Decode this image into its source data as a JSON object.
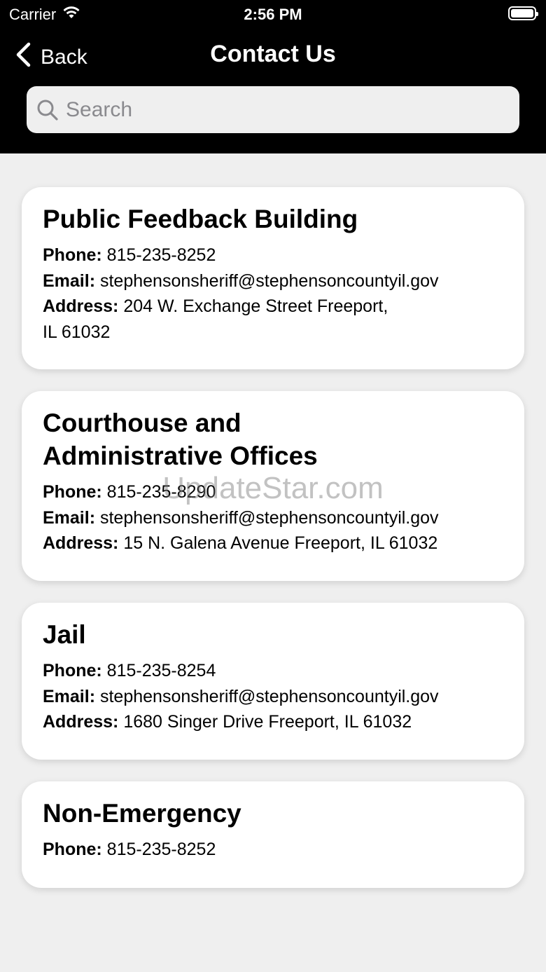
{
  "status_bar": {
    "carrier": "Carrier",
    "time": "2:56 PM"
  },
  "nav": {
    "back_label": "Back",
    "title": "Contact Us"
  },
  "search": {
    "placeholder": "Search",
    "value": ""
  },
  "labels": {
    "phone": "Phone:",
    "email": "Email:",
    "address": "Address:"
  },
  "contacts": [
    {
      "name": "Public Feedback Building",
      "phone": "815-235-8252",
      "email": "stephensonsheriff@stephensoncountyil.gov",
      "address_line1": "204 W. Exchange Street Freeport,",
      "address_line2": "IL 61032"
    },
    {
      "name_line1": "Courthouse and",
      "name_line2": "Administrative Offices",
      "phone": "815-235-8290",
      "email": "stephensonsheriff@stephensoncountyil.gov",
      "address": "15 N. Galena Avenue Freeport, IL 61032"
    },
    {
      "name": "Jail",
      "phone": "815-235-8254",
      "email": "stephensonsheriff@stephensoncountyil.gov",
      "address": "1680 Singer Drive Freeport, IL 61032"
    },
    {
      "name": "Non-Emergency",
      "phone": "815-235-8252"
    }
  ],
  "watermark": "UpdateStar.com",
  "colors": {
    "header_bg": "#000000",
    "page_bg": "#efefef",
    "card_bg": "#ffffff"
  }
}
